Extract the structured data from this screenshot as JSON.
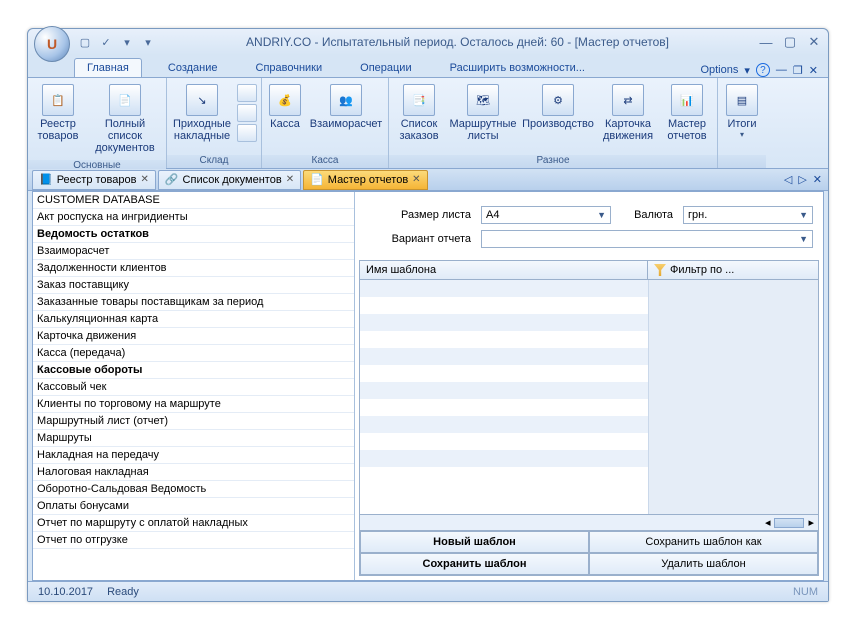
{
  "title": "ANDRIY.CO - Испытательный период. Осталось дней: 60 - [Мастер отчетов]",
  "orb": "U",
  "ribbonTabs": {
    "main": "Главная",
    "create": "Создание",
    "refs": "Справочники",
    "ops": "Операции",
    "extend": "Расширить возможности...",
    "options": "Options"
  },
  "ribbon": {
    "g1": {
      "label": "Основные",
      "b1": "Реестр товаров",
      "b2": "Полный список документов"
    },
    "g2": {
      "label": "Склад",
      "b1": "Приходные накладные"
    },
    "g3": {
      "label": "Касса",
      "b1": "Касса",
      "b2": "Взаиморасчет"
    },
    "g4": {
      "label": "Разное",
      "b1": "Список заказов",
      "b2": "Маршрутные листы",
      "b3": "Производство",
      "b4": "Карточка движения",
      "b5": "Мастер отчетов"
    },
    "g5": {
      "b1": "Итоги"
    }
  },
  "docTabs": {
    "t1": "Реестр товаров",
    "t2": "Список документов",
    "t3": "Мастер отчетов"
  },
  "reports": [
    {
      "t": "CUSTOMER DATABASE",
      "b": 0
    },
    {
      "t": "Акт роспуска на ингридиенты",
      "b": 0
    },
    {
      "t": "Ведомость остатков",
      "b": 1
    },
    {
      "t": "Взаиморасчет",
      "b": 0
    },
    {
      "t": "Задолженности клиентов",
      "b": 0
    },
    {
      "t": "Заказ поставщику",
      "b": 0
    },
    {
      "t": "Заказанные товары поставщикам за период",
      "b": 0
    },
    {
      "t": "Калькуляционная карта",
      "b": 0
    },
    {
      "t": "Карточка движения",
      "b": 0
    },
    {
      "t": "Касса (передача)",
      "b": 0
    },
    {
      "t": "Кассовые обороты",
      "b": 1
    },
    {
      "t": "Кассовый чек",
      "b": 0
    },
    {
      "t": "Клиенты по торговому на маршруте",
      "b": 0
    },
    {
      "t": "Маршрутный лист (отчет)",
      "b": 0
    },
    {
      "t": "Маршруты",
      "b": 0
    },
    {
      "t": "Накладная на передачу",
      "b": 0
    },
    {
      "t": "Налоговая накладная",
      "b": 0
    },
    {
      "t": "Оборотно-Сальдовая Ведомость",
      "b": 0
    },
    {
      "t": "Оплаты бонусами",
      "b": 0
    },
    {
      "t": "Отчет по маршруту с оплатой накладных",
      "b": 0
    },
    {
      "t": "Отчет по отгрузке",
      "b": 0
    }
  ],
  "form": {
    "sizeLabel": "Размер листа",
    "sizeValue": "A4",
    "currLabel": "Валюта",
    "currValue": "грн.",
    "variantLabel": "Вариант отчета",
    "variantValue": ""
  },
  "grid": {
    "col1": "Имя шаблона",
    "col2": "Фильтр по ..."
  },
  "buttons": {
    "newTpl": "Новый шаблон",
    "saveAs": "Сохранить шаблон как",
    "save": "Сохранить шаблон",
    "del": "Удалить шаблон"
  },
  "status": {
    "date": "10.10.2017",
    "ready": "Ready",
    "num": "NUM"
  }
}
